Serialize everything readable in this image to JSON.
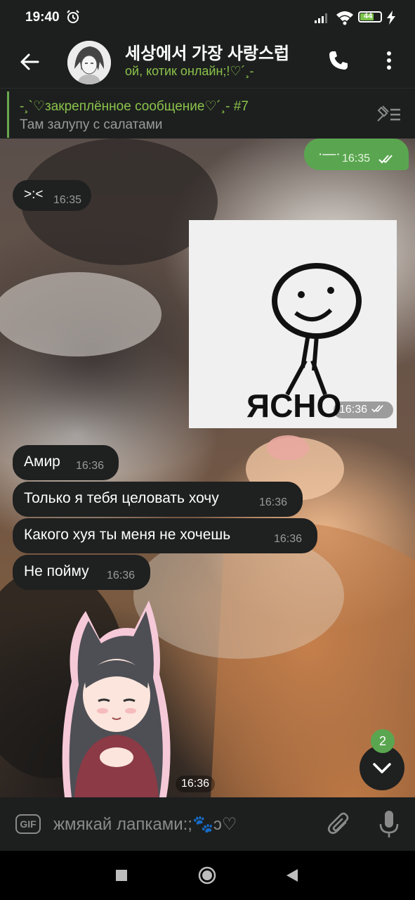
{
  "status_bar": {
    "time": "19:40",
    "battery": "44"
  },
  "header": {
    "title": "세상에서 가장 사랑스럽",
    "status": "ой, котик онлайн;!♡´¸-"
  },
  "pinned": {
    "title": "-¸`♡закреплённое сообщение♡´¸- #7",
    "text": "Там залупу с салатами"
  },
  "messages": [
    {
      "dir": "out",
      "text": "·—·",
      "time": "16:35"
    },
    {
      "dir": "in",
      "text": ">:<",
      "time": "16:35"
    },
    {
      "dir": "out",
      "sticker": "ЯСНО",
      "time": "16:36"
    },
    {
      "dir": "in",
      "text": "Амир",
      "time": "16:36"
    },
    {
      "dir": "in",
      "text": "Только я тебя целовать хочу",
      "time": "16:36"
    },
    {
      "dir": "in",
      "text": "Какого хуя ты меня не хочешь",
      "time": "16:36"
    },
    {
      "dir": "in",
      "text": "Не пойму",
      "time": "16:36"
    },
    {
      "dir": "in",
      "sticker": "anime-girl",
      "time": "16:36"
    }
  ],
  "unread_badge": "2",
  "input": {
    "gif_label": "GIF",
    "placeholder": "жмякай лапками:;🐾ↄ♡"
  },
  "colors": {
    "accent": "#5aa650",
    "status_green": "#8bc34a",
    "bar_bg": "#1d1f1f",
    "incoming_bubble": "#1f2020"
  },
  "icons": [
    "back-arrow-icon",
    "phone-icon",
    "more-vert-icon",
    "unpin-list-icon",
    "gif-icon",
    "paperclip-icon",
    "microphone-icon",
    "scroll-down-icon",
    "nav-square-icon",
    "nav-home-icon",
    "nav-back-icon"
  ]
}
